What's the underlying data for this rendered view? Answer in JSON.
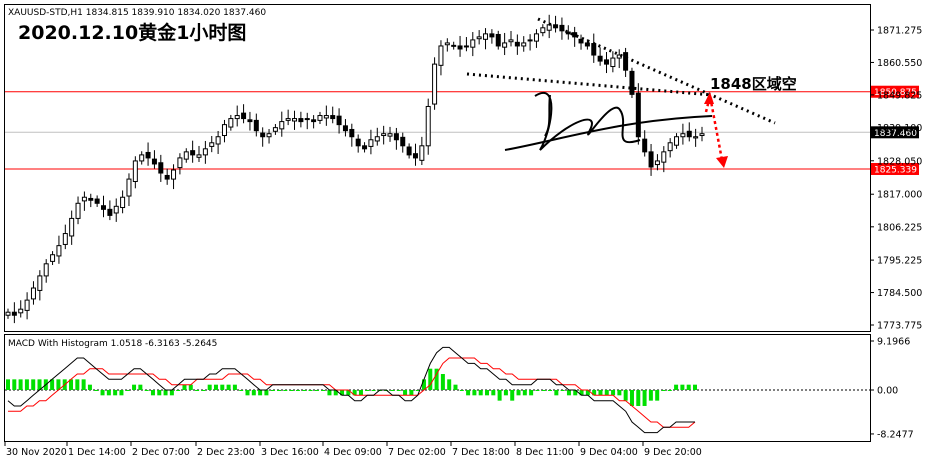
{
  "chart_data": [
    {
      "type": "candlestick",
      "header": "XAUUSD-STD,H1  1834.815 1839.910 1834.020 1837.460",
      "title": "2020.12.10黄金1小时图",
      "annotation": "1848区域空",
      "ylim": [
        1770,
        1882
      ],
      "y_ticks": [
        "1871.275",
        "1860.550",
        "1849.825",
        "1839.100",
        "1828.050",
        "1817.000",
        "1806.225",
        "1795.225",
        "1784.500",
        "1773.775"
      ],
      "horizontal_lines": [
        {
          "label": "1850.875",
          "value": 1850.875,
          "color": "#ff0000"
        },
        {
          "label": "1825.339",
          "value": 1825.339,
          "color": "#ff0000"
        }
      ],
      "current_price": {
        "label": "1837.460",
        "value": 1837.46
      },
      "x_ticks": [
        "30 Nov 2020",
        "1 Dec 14:00",
        "2 Dec 07:00",
        "2 Dec 23:00",
        "3 Dec 16:00",
        "4 Dec 09:00",
        "7 Dec 02:00",
        "7 Dec 18:00",
        "8 Dec 11:00",
        "9 Dec 04:00",
        "9 Dec 20:00"
      ],
      "colors": {
        "up": "#000000",
        "down": "#000000",
        "hline": "#ff0000",
        "arrow": "#ff0000"
      },
      "close_path": [
        1778,
        1777,
        1779,
        1782,
        1786,
        1790,
        1794,
        1797,
        1800,
        1804,
        1809,
        1814,
        1816,
        1815,
        1814,
        1812,
        1810,
        1813,
        1816,
        1822,
        1828,
        1830,
        1829,
        1827,
        1824,
        1822,
        1825,
        1829,
        1831,
        1830,
        1830,
        1832,
        1834,
        1836,
        1840,
        1842,
        1843,
        1842,
        1841,
        1838,
        1836,
        1837,
        1839,
        1841,
        1842,
        1842,
        1841,
        1842,
        1841,
        1843,
        1843,
        1842,
        1840,
        1838,
        1836,
        1833,
        1832,
        1835,
        1836,
        1837,
        1837,
        1835,
        1833,
        1830,
        1829,
        1833,
        1846,
        1860,
        1866,
        1867,
        1866,
        1865,
        1866,
        1868,
        1869,
        1870,
        1869,
        1866,
        1867,
        1868,
        1866,
        1867,
        1868,
        1870,
        1872,
        1873,
        1872,
        1871,
        1870,
        1869,
        1867,
        1866,
        1863,
        1861,
        1860,
        1862,
        1863,
        1858,
        1850,
        1836,
        1831,
        1826,
        1828,
        1831,
        1834,
        1836,
        1837,
        1836,
        1836,
        1837
      ]
    },
    {
      "type": "macd",
      "title": "MACD With Histogram 1.0518 -6.3163 -5.2645",
      "ylim": [
        -9,
        10
      ],
      "y_ticks": [
        "9.1966",
        "0.00",
        "-8.2477"
      ],
      "macd_line": [
        -2,
        -3,
        -3,
        -2,
        -1,
        0,
        1,
        2,
        3,
        4,
        5,
        6,
        6,
        5,
        4,
        3,
        2,
        2,
        2,
        3,
        4,
        4,
        3,
        2,
        1,
        0,
        0,
        1,
        2,
        2,
        2,
        2,
        3,
        3,
        4,
        4,
        4,
        3,
        2,
        1,
        0,
        0,
        1,
        1,
        1,
        1,
        1,
        1,
        1,
        1,
        1,
        0,
        0,
        -1,
        -1,
        -2,
        -2,
        -1,
        -1,
        0,
        0,
        -1,
        -1,
        -2,
        -2,
        -1,
        2,
        5,
        7,
        8,
        8,
        7,
        6,
        5,
        5,
        4,
        4,
        3,
        2,
        2,
        1,
        1,
        1,
        1,
        2,
        2,
        2,
        1,
        1,
        0,
        0,
        -1,
        -1,
        -2,
        -2,
        -2,
        -2,
        -3,
        -4,
        -6,
        -7,
        -8,
        -8,
        -8,
        -7,
        -7,
        -6,
        -6,
        -6,
        -6
      ],
      "signal_line": [
        -4,
        -4,
        -4,
        -3,
        -3,
        -2,
        -2,
        -1,
        0,
        1,
        2,
        3,
        3,
        4,
        4,
        4,
        3,
        3,
        3,
        3,
        3,
        3,
        3,
        3,
        2,
        2,
        1,
        1,
        1,
        1,
        2,
        2,
        2,
        2,
        2,
        3,
        3,
        3,
        3,
        2,
        2,
        1,
        1,
        1,
        1,
        1,
        1,
        1,
        1,
        1,
        1,
        1,
        0,
        0,
        0,
        -1,
        -1,
        -1,
        -1,
        -1,
        -1,
        -1,
        -1,
        -1,
        -1,
        -1,
        0,
        1,
        3,
        5,
        6,
        6,
        6,
        6,
        6,
        5,
        5,
        4,
        4,
        3,
        3,
        2,
        2,
        2,
        2,
        2,
        2,
        2,
        1,
        1,
        1,
        0,
        0,
        -1,
        -1,
        -1,
        -1,
        -2,
        -2,
        -3,
        -4,
        -5,
        -6,
        -6,
        -7,
        -7,
        -7,
        -7,
        -7,
        -6
      ],
      "histogram": [
        2,
        2,
        2,
        2,
        2,
        2,
        2,
        2,
        2,
        2,
        2,
        2,
        2,
        1,
        0,
        -1,
        -1,
        -1,
        -1,
        0,
        1,
        1,
        0,
        -1,
        -1,
        -1,
        -1,
        0,
        1,
        1,
        0,
        0,
        1,
        1,
        1,
        1,
        1,
        0,
        -1,
        -1,
        -1,
        -1,
        0,
        0,
        0,
        0,
        0,
        0,
        0,
        0,
        0,
        -1,
        -1,
        -1,
        -1,
        -1,
        -1,
        0,
        0,
        0,
        0,
        0,
        0,
        -1,
        -1,
        0,
        2,
        4,
        4,
        3,
        2,
        1,
        0,
        -1,
        -1,
        -1,
        -1,
        -1,
        -2,
        -1,
        -2,
        -1,
        -1,
        -1,
        0,
        0,
        0,
        -1,
        0,
        -1,
        -1,
        -1,
        -1,
        -1,
        -1,
        -1,
        -1,
        -1,
        -2,
        -3,
        -3,
        -3,
        -2,
        -2,
        0,
        0,
        1,
        1,
        1,
        1
      ]
    }
  ]
}
